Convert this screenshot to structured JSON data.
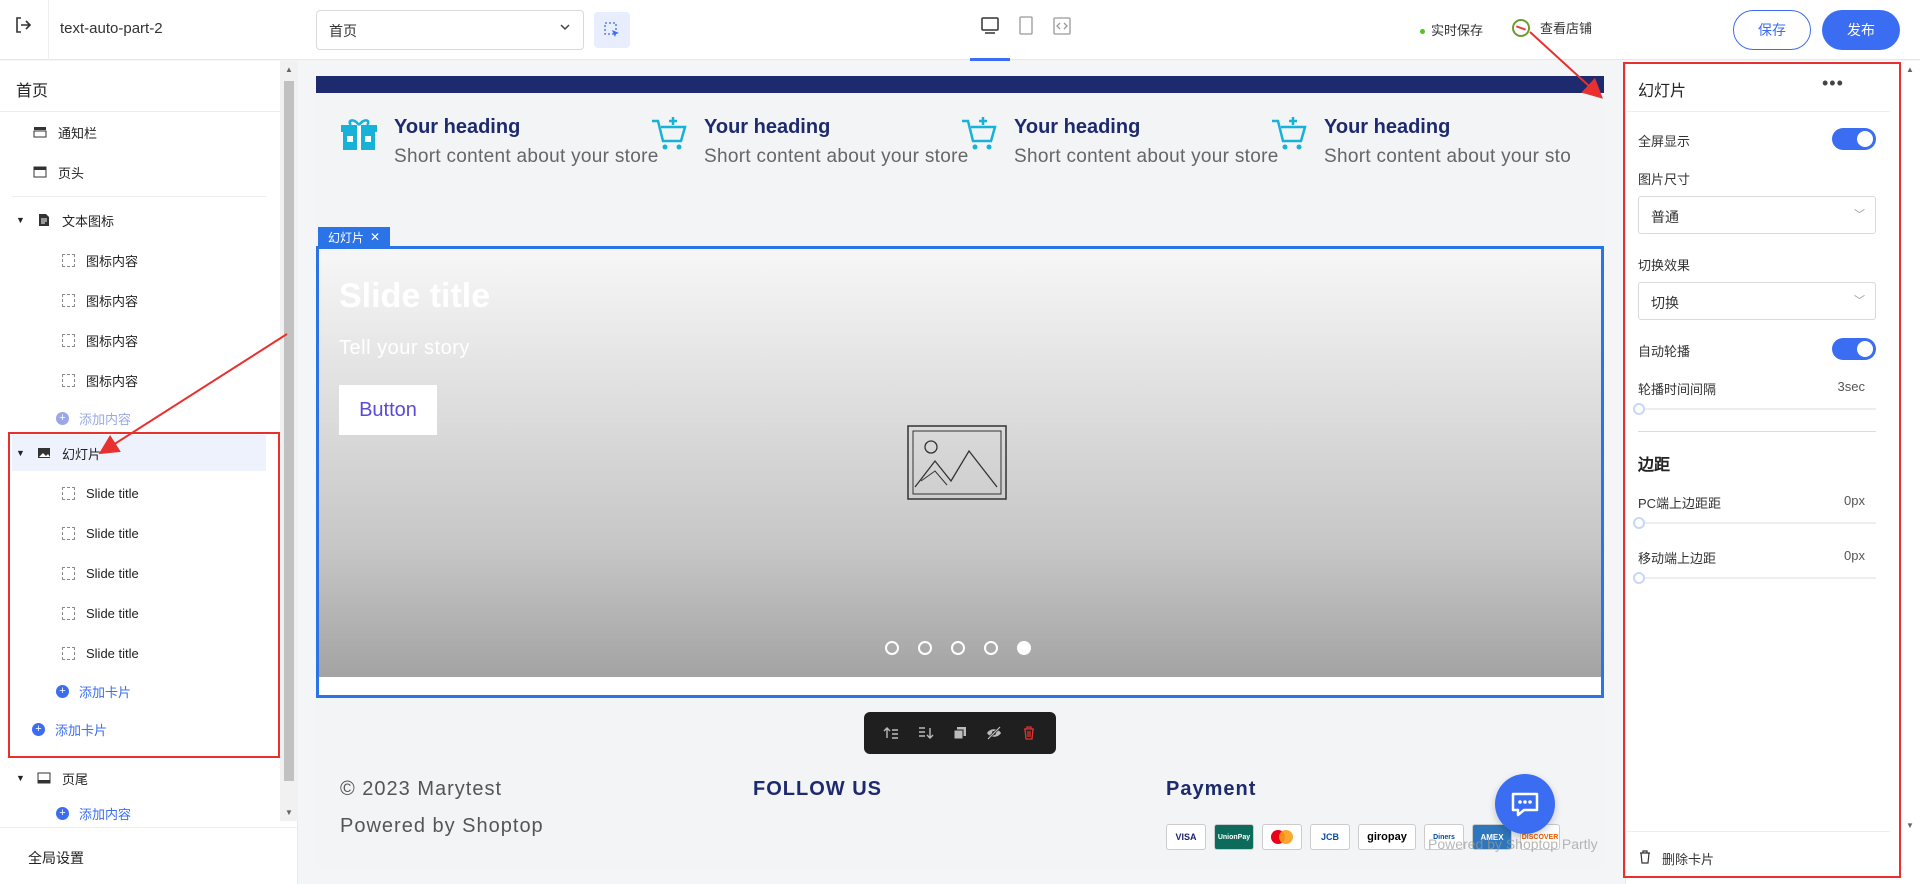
{
  "topbar": {
    "site_name": "text-auto-part-2",
    "page_select_value": "首页",
    "save_status": "实时保存",
    "view_store": "查看店铺",
    "save_label": "保存",
    "publish_label": "发布"
  },
  "sidebar": {
    "page_title": "首页",
    "items": [
      {
        "label": "通知栏"
      },
      {
        "label": "页头"
      },
      {
        "label": "文本图标"
      },
      {
        "label": "图标内容"
      },
      {
        "label": "图标内容"
      },
      {
        "label": "图标内容"
      },
      {
        "label": "图标内容"
      },
      {
        "label": "添加内容"
      },
      {
        "label": "幻灯片"
      },
      {
        "label": "Slide title"
      },
      {
        "label": "Slide title"
      },
      {
        "label": "Slide title"
      },
      {
        "label": "Slide title"
      },
      {
        "label": "Slide title"
      },
      {
        "label": "添加卡片"
      },
      {
        "label": "添加卡片"
      },
      {
        "label": "页尾"
      },
      {
        "label": "添加内容"
      }
    ],
    "global_settings": "全局设置"
  },
  "canvas": {
    "features": [
      {
        "heading": "Your heading",
        "text": "Short content about your store",
        "icon": "gift-icon"
      },
      {
        "heading": "Your heading",
        "text": "Short content about your store",
        "icon": "cart-icon"
      },
      {
        "heading": "Your heading",
        "text": "Short content about your store",
        "icon": "cart-icon"
      },
      {
        "heading": "Your heading",
        "text": "Short content about your sto",
        "icon": "cart-icon"
      }
    ],
    "slide_tag": "幻灯片",
    "slide": {
      "title": "Slide title",
      "subtitle": "Tell your story",
      "button": "Button",
      "dots_total": 5,
      "active_dot": 5
    },
    "footer": {
      "copyright": "© 2023 Marytest",
      "powered": "Powered by Shoptop",
      "follow": "FOLLOW US",
      "payment": "Payment",
      "powered_faint": "Powered by Shoptop Partly",
      "cards": [
        "VISA",
        "UnionPay",
        "",
        "JCB",
        "giropay",
        "Diners",
        "AMEX",
        "DISCOVER"
      ]
    }
  },
  "panel": {
    "title": "幻灯片",
    "fullscreen_label": "全屏显示",
    "fullscreen_on": true,
    "image_size_label": "图片尺寸",
    "image_size_value": "普通",
    "transition_label": "切换效果",
    "transition_value": "切换",
    "autoplay_label": "自动轮播",
    "autoplay_on": true,
    "interval_label": "轮播时间间隔",
    "interval_value": "3sec",
    "margin_section": "边距",
    "pc_margin_label": "PC端上边距距",
    "pc_margin_value": "0px",
    "mobile_margin_label": "移动端上边距",
    "mobile_margin_value": "0px",
    "delete_label": "删除卡片"
  },
  "colors": {
    "accent": "#3b6df3",
    "navy": "#1d2a6e",
    "annotation_red": "#e8312f",
    "selection_blue": "#2a74e8"
  }
}
